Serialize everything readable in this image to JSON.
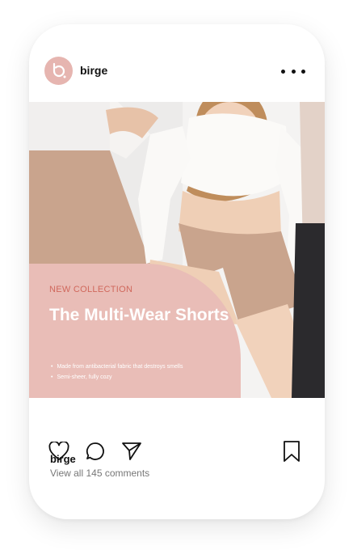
{
  "post": {
    "username": "birge",
    "avatar_icon": "birge-logo-icon",
    "more_icon": "more-dots-icon"
  },
  "promo": {
    "tag": "NEW COLLECTION",
    "headline": "The Multi-Wear Shorts",
    "bullets": [
      "Made from antibacterial fabric that destroys smells",
      "Semi-sheer, fully cozy"
    ]
  },
  "actions": {
    "icons": [
      "heart-icon",
      "comment-icon",
      "send-icon",
      "bookmark-icon"
    ]
  },
  "footer": {
    "username": "birge",
    "comments_link": "View all 145 comments"
  },
  "colors": {
    "brand_pink": "#e6b5b0",
    "overlay_pink": "#e9bdb7",
    "tag_red": "#d0685c"
  }
}
